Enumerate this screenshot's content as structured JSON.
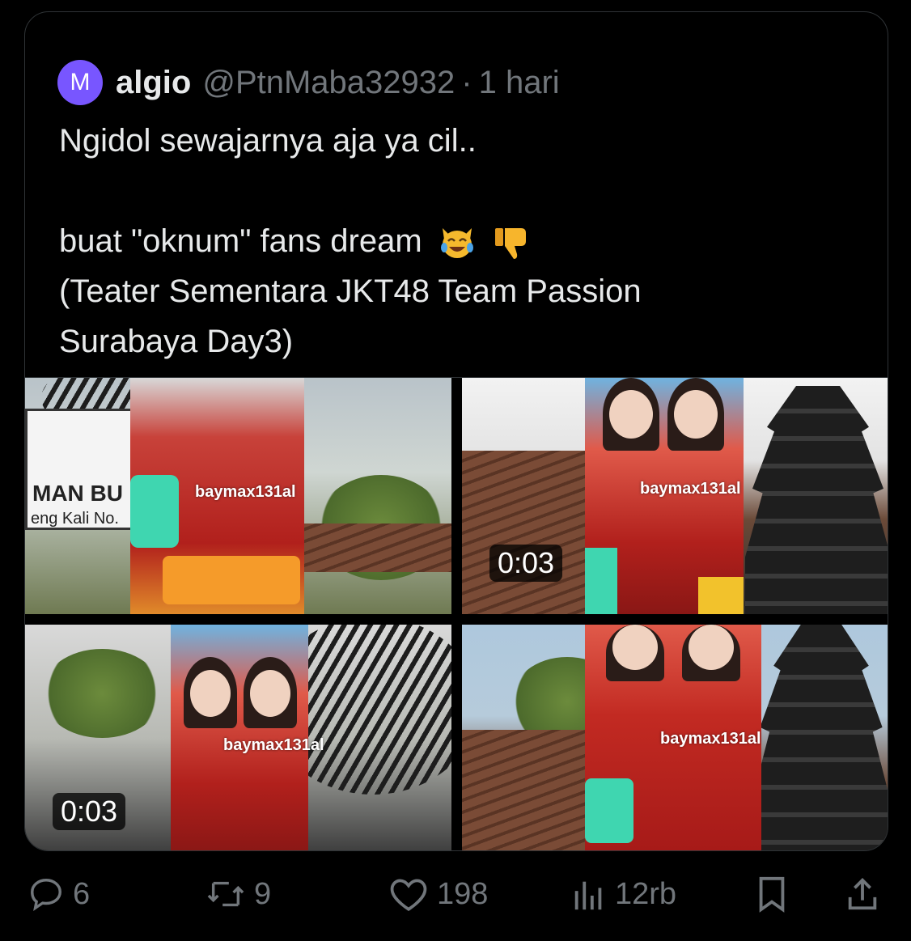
{
  "tweet": {
    "avatar_letter": "M",
    "avatar_color": "#7856ff",
    "display_name": "algio",
    "handle": "@PtnMaba32932",
    "separator": "·",
    "time": "1 hari",
    "text_line1": "Ngidol sewajarnya aja ya cil..",
    "text_line2": "buat \"oknum\" fans dream",
    "emojis": [
      "crying-laughing-cat-emoji",
      "thumbs-down-emoji"
    ],
    "text_line3": "(Teater Sementara JKT48 Team Passion",
    "text_line4": "Surabaya Day3)"
  },
  "media": [
    {
      "kind": "image",
      "sign_title": "MAN BU",
      "sign_sub": "eng Kali No.",
      "watermark": "baymax131al"
    },
    {
      "kind": "video",
      "duration": "0:03",
      "watermark": "baymax131al"
    },
    {
      "kind": "video",
      "duration": "0:03",
      "watermark": "baymax131al"
    },
    {
      "kind": "image",
      "watermark": "baymax131al"
    }
  ],
  "actions": {
    "replies": "6",
    "reposts": "9",
    "likes": "198",
    "views": "12rb"
  },
  "colors": {
    "background": "#000000",
    "text": "#e7e9ea",
    "muted": "#71767b",
    "border": "#2f3336"
  }
}
